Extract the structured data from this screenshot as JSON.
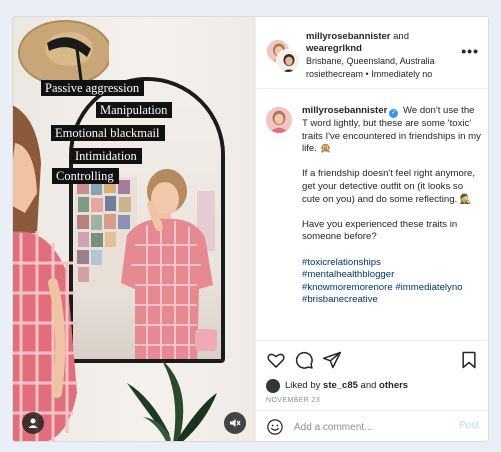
{
  "photo": {
    "overlay_labels": [
      "Passive aggression",
      "Manipulation",
      "Emotional blackmail",
      "Intimidation",
      "Controlling"
    ]
  },
  "header": {
    "user1": "millyrosebannister",
    "and_word": "and",
    "user2": "wearegrlknd",
    "location": "Brisbane, Queensland, Australia",
    "audio": "rosiethecream",
    "separator": "•",
    "audio_tag": "Immediately no",
    "more": "•••"
  },
  "caption": {
    "username": "millyrosebannister",
    "verified": "✓",
    "para1": "We don't use the T word lightly, but these are some 'toxic' traits I've encountered in friendships in my life. 🙊",
    "para2": "If a friendship doesn't feel right anymore, get your detective outfit on (it looks so cute on you) and do some reflecting. 🕵",
    "para3": "Have you experienced these traits in someone before?",
    "hashtags": [
      "#toxicrelationships",
      "#mentalhealthblogger",
      "#knowmoremorenore #immediatelyno",
      "#brisbanecreative"
    ]
  },
  "actions": {
    "liked_prefix": "Liked by",
    "liked_user": "ste_c85",
    "liked_and": "and",
    "liked_others": "others",
    "date": "NOVEMBER 23"
  },
  "comment": {
    "placeholder": "Add a comment...",
    "post_label": "Post"
  },
  "icons": {
    "like": "heart-icon",
    "comment": "comment-icon",
    "share": "paper-plane-icon",
    "save": "bookmark-icon",
    "emoji": "smiley-icon",
    "tag": "person-tag-icon",
    "mute": "speaker-muted-icon"
  },
  "colors": {
    "link": "#00376b",
    "verified": "#3897f0",
    "post_disabled": "#b2dffc",
    "muted_text": "#8e8e8e"
  }
}
